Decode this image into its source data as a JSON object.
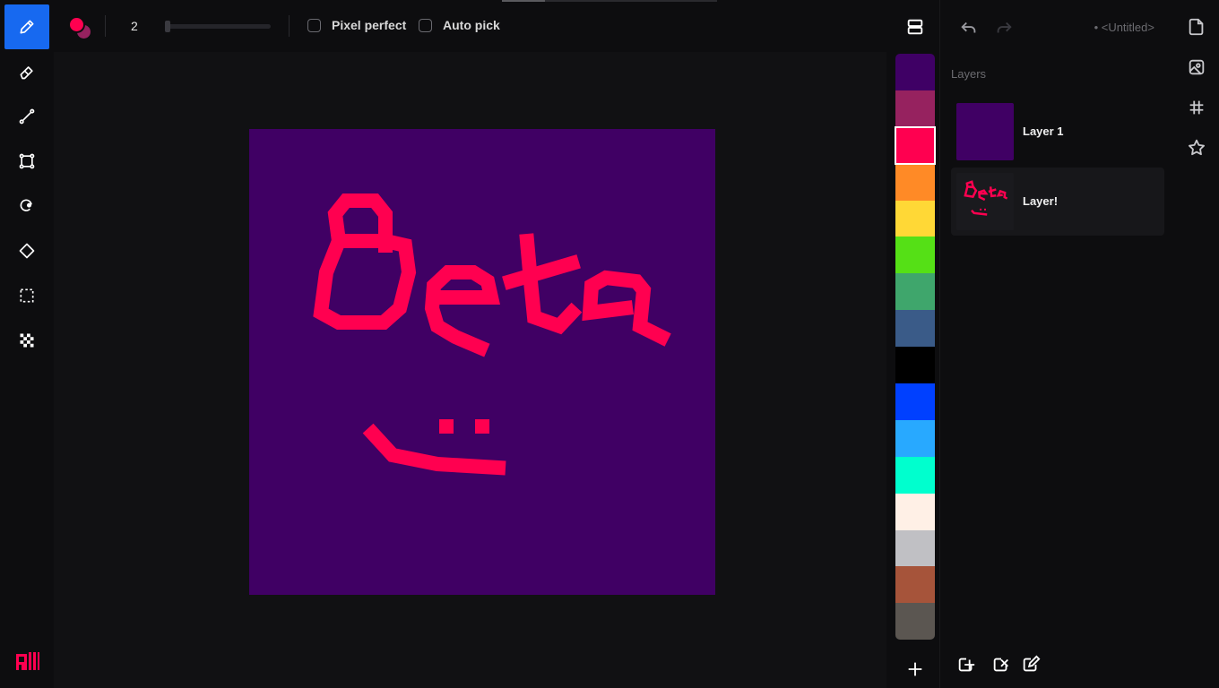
{
  "tools": [
    {
      "name": "pencil-tool",
      "icon": "pencil-icon",
      "active": true
    },
    {
      "name": "eraser-tool",
      "icon": "eraser-icon",
      "active": false
    },
    {
      "name": "line-tool",
      "icon": "line-icon",
      "active": false
    },
    {
      "name": "rectangle-tool",
      "icon": "rectangle-icon",
      "active": false
    },
    {
      "name": "fill-tool",
      "icon": "fill-icon",
      "active": false
    },
    {
      "name": "shape-tool",
      "icon": "diamond-icon",
      "active": false
    },
    {
      "name": "select-tool",
      "icon": "selection-icon",
      "active": false
    },
    {
      "name": "checker-tool",
      "icon": "checkerboard-icon",
      "active": false
    }
  ],
  "toolbar": {
    "primary_color": "#ff0050",
    "secondary_color": "#96225f",
    "brush_size": "2",
    "pixel_perfect_label": "Pixel perfect",
    "auto_pick_label": "Auto pick"
  },
  "palette": {
    "colors": [
      "#3f0065",
      "#96225f",
      "#ff0050",
      "#ff8a26",
      "#ffd836",
      "#55e016",
      "#3fa66c",
      "#3a5b88",
      "#000000",
      "#0040ff",
      "#28a9ff",
      "#00ffce",
      "#fff0e6",
      "#c0c0c4",
      "#a6543a",
      "#5b5651"
    ],
    "selected_index": 2,
    "accent": "#1769f0"
  },
  "document": {
    "title": "• <Untitled>"
  },
  "layers_panel": {
    "title": "Layers",
    "layers": [
      {
        "name": "Layer 1",
        "active": false
      },
      {
        "name": "Layer!",
        "active": true
      }
    ]
  }
}
